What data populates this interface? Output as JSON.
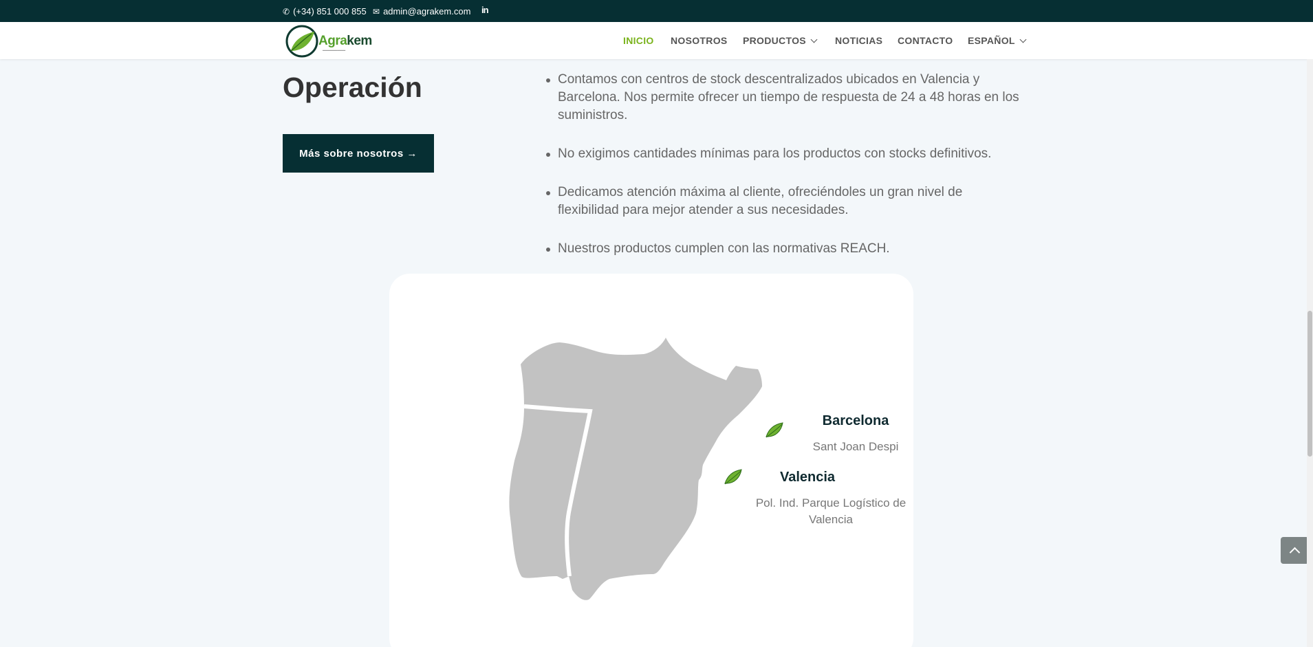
{
  "topbar": {
    "phone": "(+34) 851 000 855",
    "email": "admin@agrakem.com",
    "linkedin_icon": "linkedin-icon"
  },
  "logo": {
    "word_a": "Agra",
    "word_b": "kem"
  },
  "nav": {
    "items": [
      {
        "label": "INICIO",
        "active": true
      },
      {
        "label": "NOSOTROS"
      },
      {
        "label": "PRODUCTOS",
        "has_dropdown": true
      },
      {
        "label": "NOTICIAS"
      },
      {
        "label": "CONTACTO"
      },
      {
        "label": "ESPAÑOL",
        "has_dropdown": true
      }
    ]
  },
  "section": {
    "heading": "Operación",
    "cta_label": "Más sobre nosotros →",
    "bullets": [
      "Contamos con centros de stock descentralizados ubicados en Valencia y Barcelona. Nos permite ofrecer un tiempo de respuesta de 24 a 48 horas en los suministros.",
      "No exigimos cantidades mínimas para los productos con stocks definitivos.",
      "Dedicamos atención máxima al cliente, ofreciéndoles un gran nivel de flexibilidad para mejor atender a sus necesidades.",
      "Nuestros productos cumplen con las normativas REACH."
    ]
  },
  "map": {
    "locations": [
      {
        "city": "Barcelona",
        "detail": "Sant Joan Despi",
        "marker_icon": "leaf-icon"
      },
      {
        "city": "Valencia",
        "detail": "Pol. Ind. Parque Logístico de Valencia",
        "marker_icon": "leaf-icon"
      }
    ]
  },
  "colors": {
    "brand_dark": "#062f33",
    "accent_green": "#7ab31c",
    "map_fill": "#c2c2c2"
  }
}
